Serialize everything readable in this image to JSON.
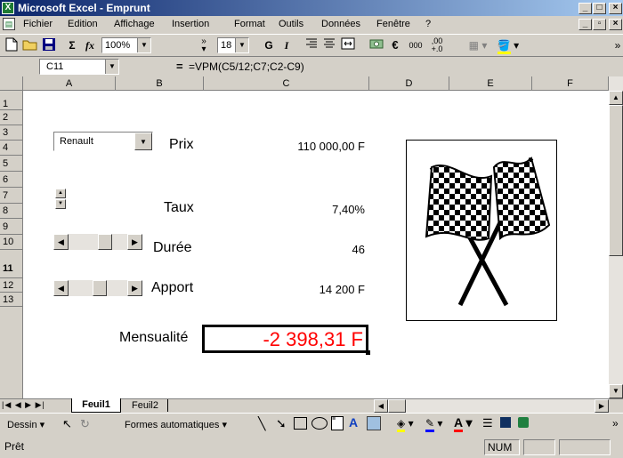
{
  "window": {
    "title": "Microsoft Excel - Emprunt",
    "controls": [
      "_",
      "□",
      "X"
    ],
    "doc_controls": [
      "_",
      "🗗",
      "X"
    ]
  },
  "menu": {
    "items": [
      "Fichier",
      "Edition",
      "Affichage",
      "Insertion",
      "Format",
      "Outils",
      "Données",
      "Fenêtre",
      "?"
    ]
  },
  "toolbar": {
    "zoom": "100%",
    "font_size": "18",
    "bold": "G",
    "italic": "I",
    "sigma": "Σ",
    "fx": "fx",
    "euro": "€",
    "thousands": "000",
    "decimals": ",00"
  },
  "formula_bar": {
    "name_box": "C11",
    "equals": "=",
    "formula": "=VPM(C5/12;C7;C2-C9)"
  },
  "sheet": {
    "columns": [
      "A",
      "B",
      "C",
      "D",
      "E",
      "F"
    ],
    "rows": [
      "1",
      "2",
      "3",
      "4",
      "5",
      "6",
      "7",
      "8",
      "9",
      "10",
      "11",
      "12",
      "13"
    ],
    "dropdown_value": "Renault",
    "labels": {
      "prix": "Prix",
      "taux": "Taux",
      "duree": "Durée",
      "apport": "Apport",
      "mensualite": "Mensualité"
    },
    "values": {
      "prix": "110 000,00 F",
      "taux": "7,40%",
      "duree": "46",
      "apport": "14 200 F",
      "mensualite": "-2 398,31 F"
    },
    "result_color": "#ff0000"
  },
  "tabs": {
    "items": [
      "Feuil1",
      "Feuil2"
    ],
    "active": "Feuil1"
  },
  "drawing": {
    "dessin": "Dessin",
    "formes": "Formes automatiques"
  },
  "status": {
    "ready": "Prêt",
    "num": "NUM"
  },
  "colors": {
    "titlebar": "#0a246a",
    "excel_green": "#1e7b34",
    "result_red": "#ff0000"
  }
}
